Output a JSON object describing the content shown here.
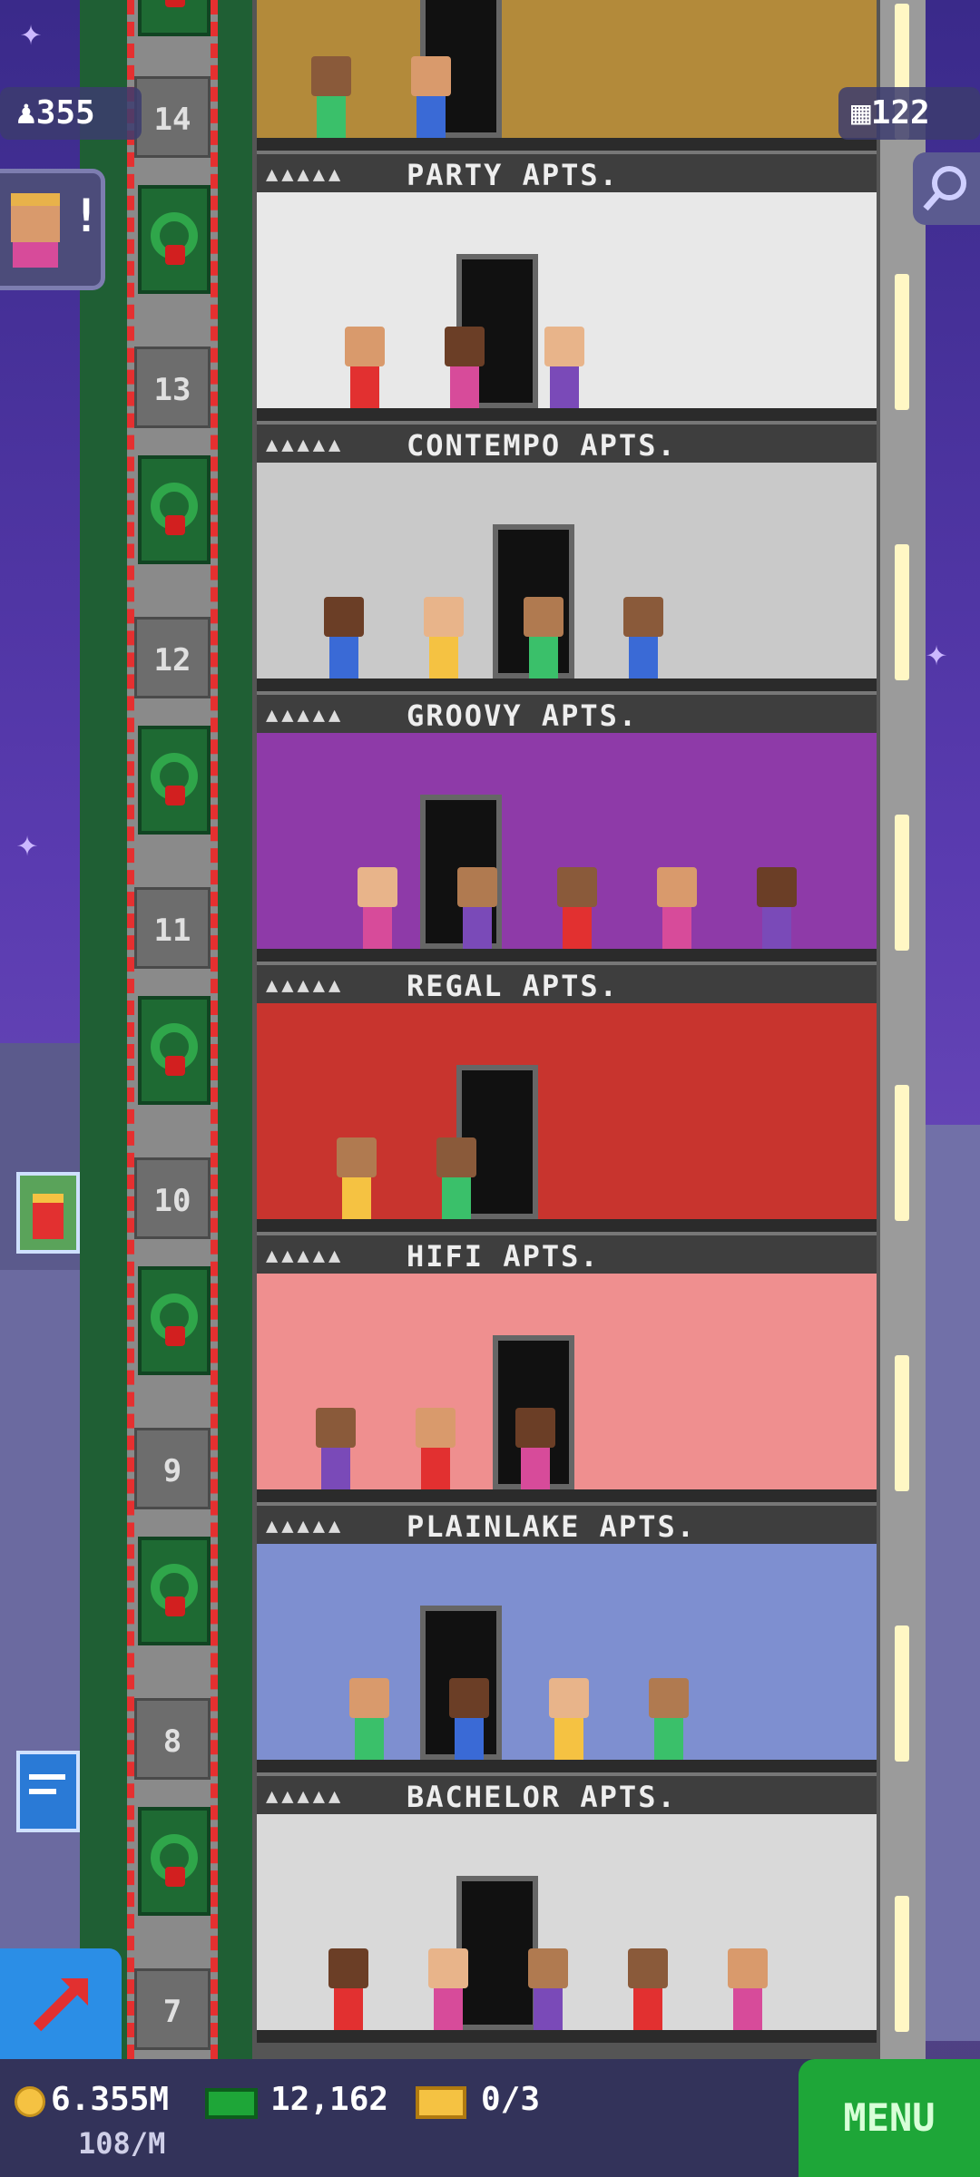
{
  "hud": {
    "population": "355",
    "floors": "122",
    "notification_mark": "!",
    "icons": [
      "person-icon",
      "building-icon",
      "search-icon",
      "elevator-arrow-icon",
      "coin-icon",
      "bux-icon",
      "ticket-icon"
    ]
  },
  "floors": [
    {
      "number": "14",
      "sign": "PARTY APTS.",
      "wall": "#b38a3a"
    },
    {
      "number": "13",
      "sign": "CONTEMPO APTS.",
      "wall": "#e8e8e8"
    },
    {
      "number": "12",
      "sign": "GROOVY APTS.",
      "wall": "#c9c9c9"
    },
    {
      "number": "11",
      "sign": "REGAL APTS.",
      "wall": "#8e3aa8"
    },
    {
      "number": "10",
      "sign": "HIFI APTS.",
      "wall": "#c8342e"
    },
    {
      "number": "9",
      "sign": "PLAINLAKE APTS.",
      "wall": "#ef8f8f"
    },
    {
      "number": "8",
      "sign": "BACHELOR APTS.",
      "wall": "#7e8fd0"
    },
    {
      "number": "7",
      "sign": "",
      "wall": "#d9d9d9"
    }
  ],
  "stats": {
    "coins": "6.355M",
    "coins_rate": "108/M",
    "bux": "12,162",
    "tickets": "0/3"
  },
  "menu_label": "MENU",
  "sign_dots": "▲▲▲▲▲",
  "colors": {
    "accent_green": "#1ea638",
    "elevator_blue": "#2b8ee6",
    "shaft_stripe": "#e53030"
  }
}
